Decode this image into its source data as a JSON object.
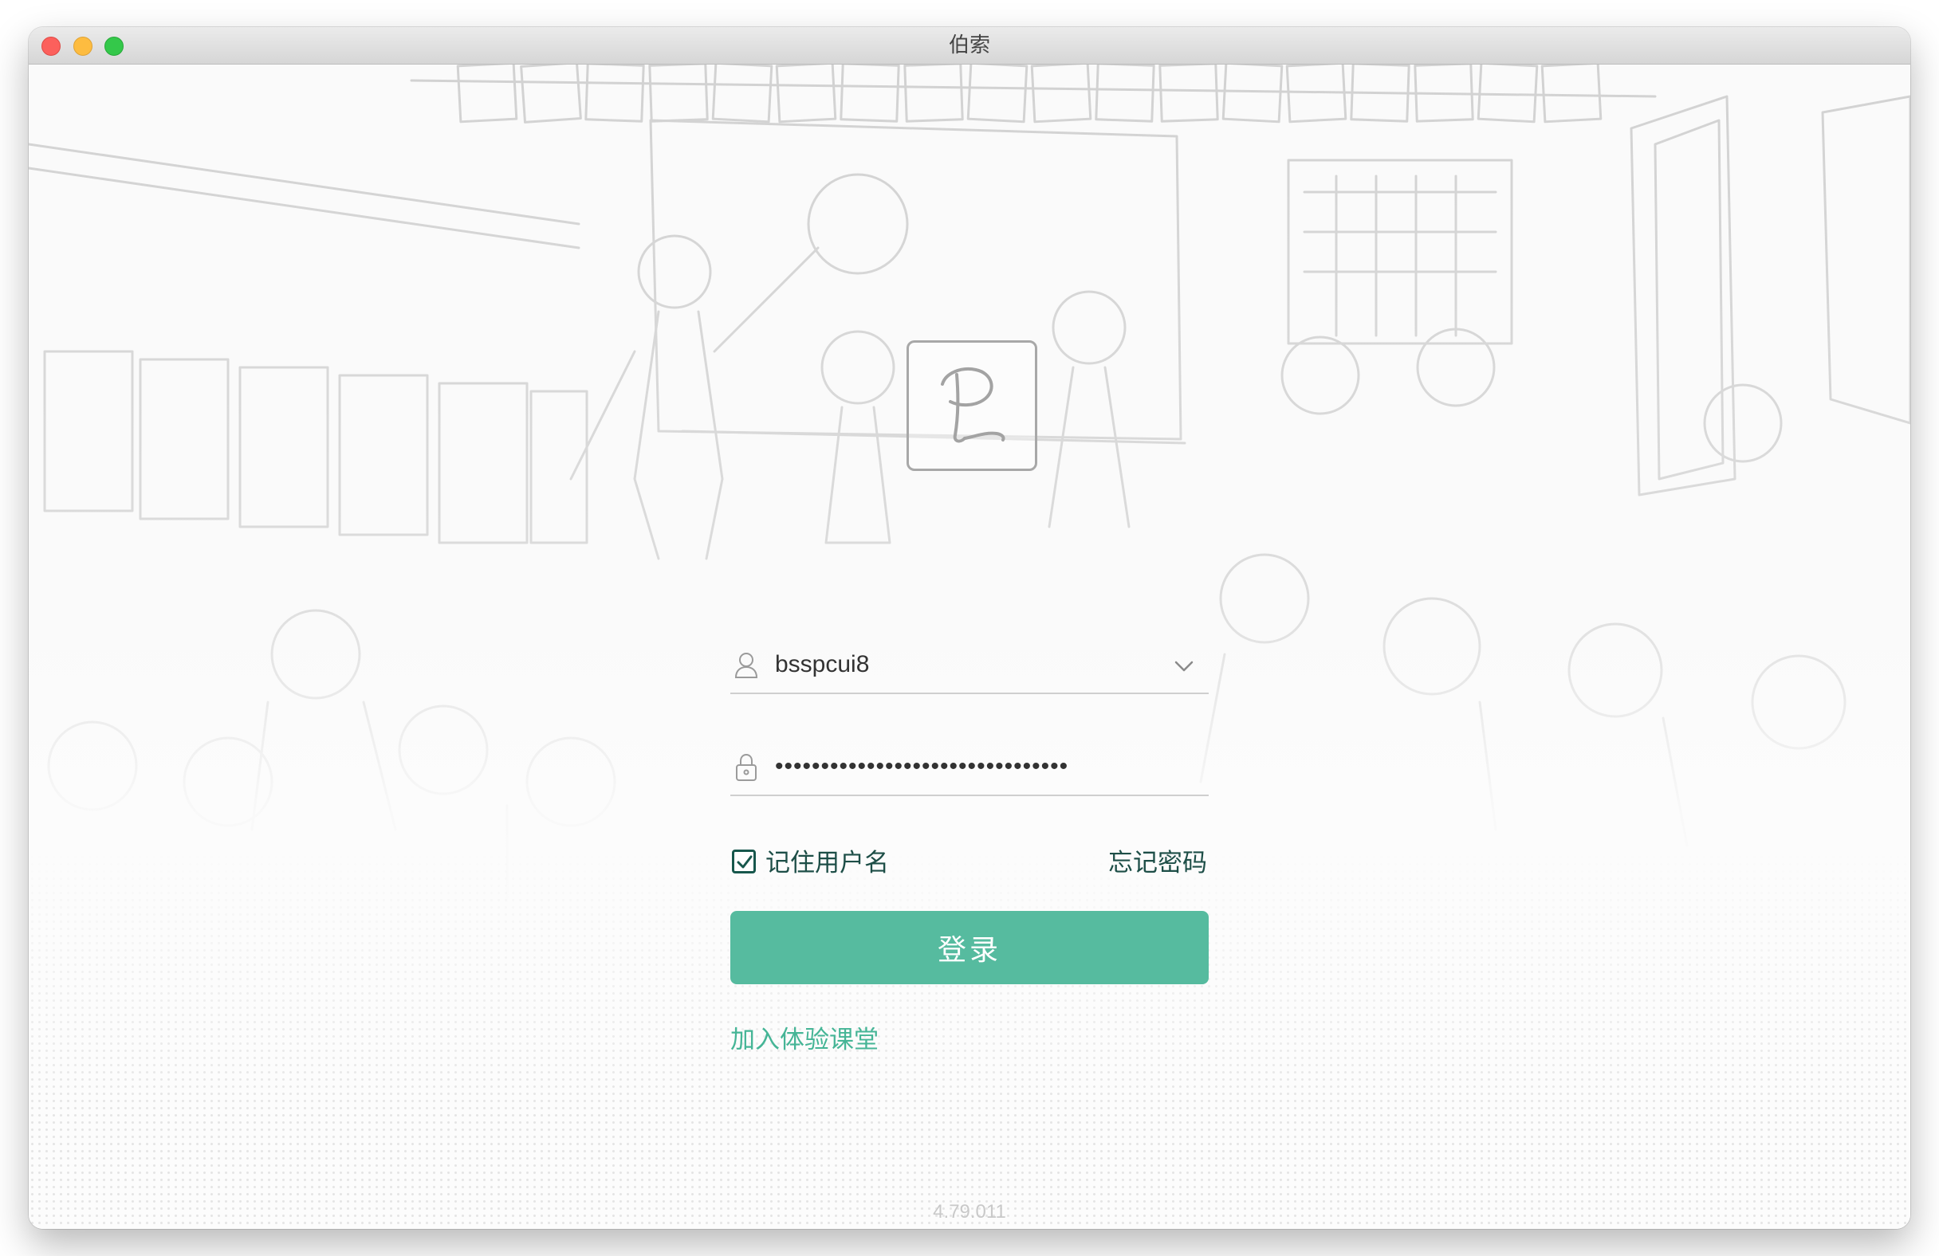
{
  "window": {
    "title": "伯索"
  },
  "login": {
    "username_value": "bsspcui8",
    "password_value": "••••••••••••••••••••••••••••••••",
    "remember_label": "记住用户名",
    "remember_checked": true,
    "forgot_label": "忘记密码",
    "login_button_label": "登录",
    "trial_link_label": "加入体验课堂"
  },
  "footer": {
    "version": "4.79.011"
  },
  "icons": {
    "user": "user-icon",
    "lock": "lock-icon",
    "dropdown": "chevron-down-icon",
    "check": "checkmark-icon",
    "logo": "app-logo"
  },
  "colors": {
    "accent": "#56bb9f",
    "link": "#45b596",
    "label_text": "#1d4e47"
  }
}
